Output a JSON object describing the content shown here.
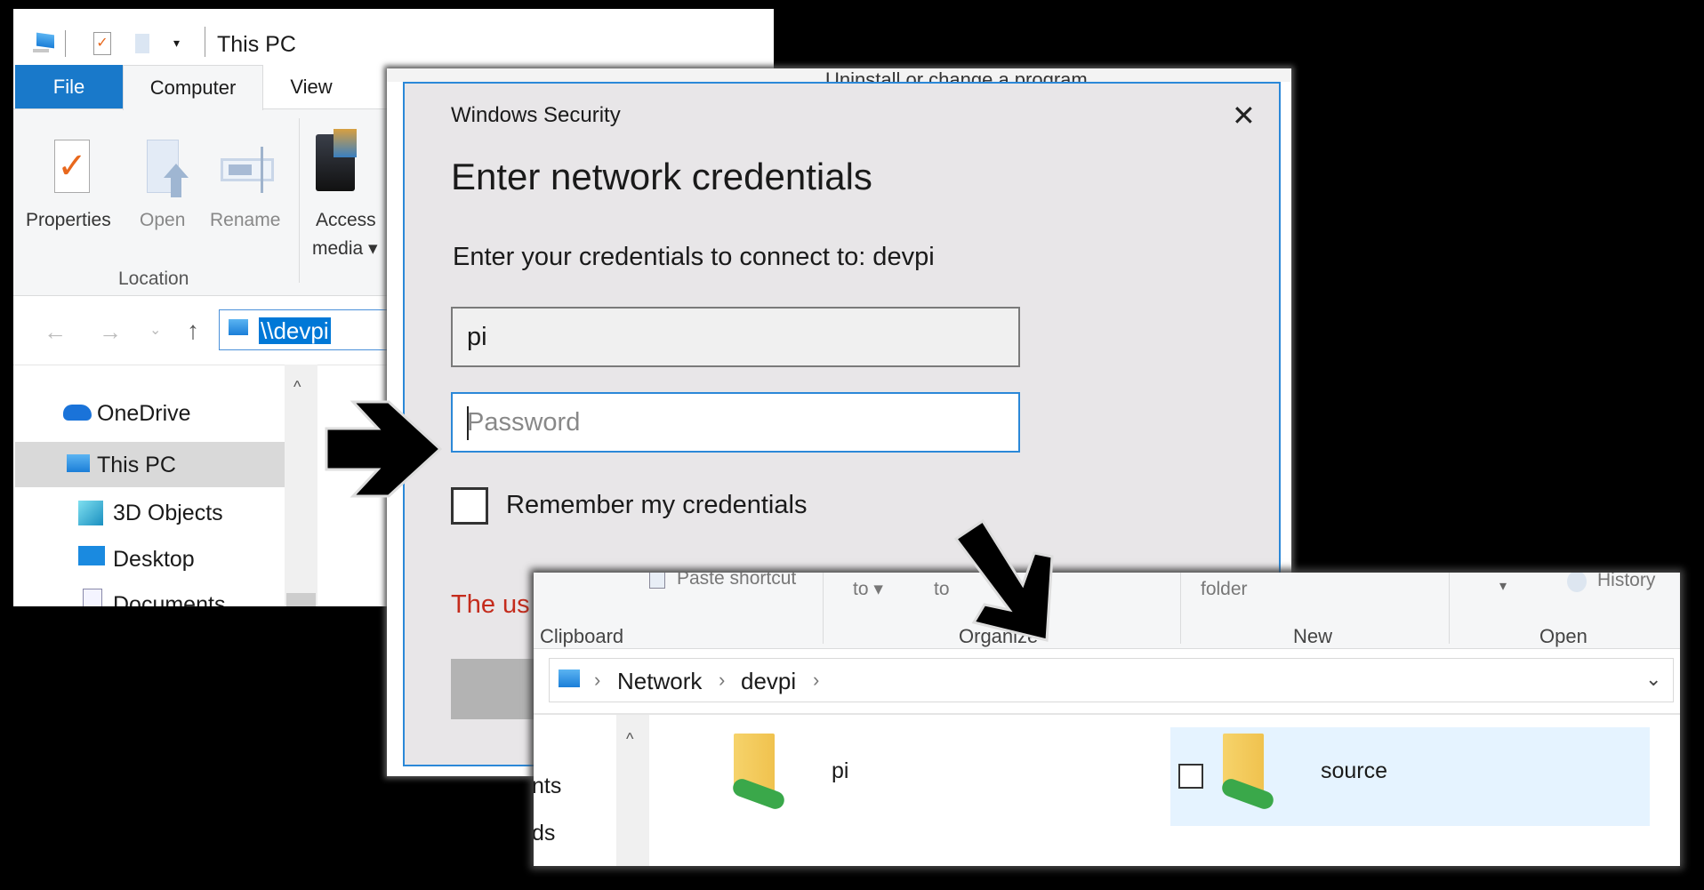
{
  "explorer_back": {
    "title": "This PC",
    "tabs": [
      "File",
      "Computer",
      "View"
    ],
    "ribbon": {
      "buttons": [
        "Properties",
        "Open",
        "Rename"
      ],
      "access_media": [
        "Access",
        "media"
      ],
      "group_label": "Location"
    },
    "address": "\\\\devpi",
    "nav": [
      "OneDrive",
      "This PC",
      "3D Objects",
      "Desktop",
      "Documents"
    ],
    "background_partial_text": "Uninstall or change a program"
  },
  "dialog": {
    "window_title": "Windows Security",
    "heading": "Enter network credentials",
    "prompt": "Enter your credentials to connect to: devpi",
    "username_value": "pi",
    "password_placeholder": "Password",
    "remember_label": "Remember my credentials",
    "remember_checked": false,
    "error_partial": "The us",
    "accent": "#2b88d8",
    "error_color": "#c42b1c"
  },
  "explorer_front": {
    "ribbon_partial": {
      "paste_shortcut": "Paste shortcut",
      "move_to": "to",
      "copy_to": "to",
      "new_folder": "folder",
      "history": "History"
    },
    "groups": [
      "Clipboard",
      "Organize",
      "New",
      "Open"
    ],
    "breadcrumb": [
      "Network",
      "devpi"
    ],
    "nav_partial": [
      "nts",
      "ds"
    ],
    "items": [
      {
        "name": "pi",
        "selected": false
      },
      {
        "name": "source",
        "selected": true
      }
    ]
  }
}
